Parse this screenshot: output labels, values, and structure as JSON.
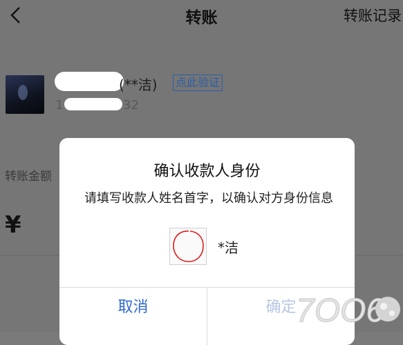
{
  "nav": {
    "title": "转账",
    "right_link": "转账记录"
  },
  "recipient": {
    "name_suffix": "(**洁)",
    "verify_label": "点此验证",
    "account_prefix": "1",
    "account_suffix": "32"
  },
  "transfer": {
    "amount_label": "转账金额",
    "currency_symbol": "¥"
  },
  "dialog": {
    "title": "确认收款人身份",
    "message": "请填写收款人姓名首字，以确认对方身份信息",
    "hidden_name": "*洁",
    "cancel_label": "取消",
    "confirm_label": "确定"
  },
  "watermark": {
    "text": "7OO6"
  },
  "colors": {
    "link_blue": "#2f6ad0",
    "confirm_disabled": "#b7c7e4",
    "annotation_red": "#e01b1b"
  }
}
